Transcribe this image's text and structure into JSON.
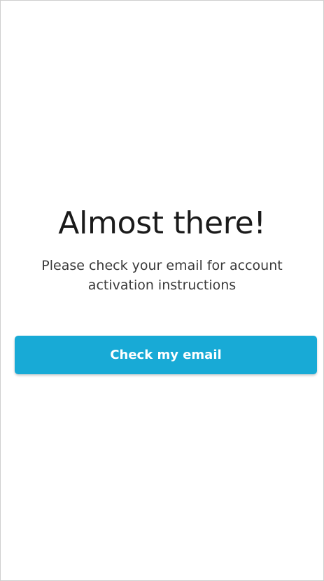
{
  "confirmation": {
    "title": "Almost there!",
    "message": "Please check your email for account activation instructions",
    "button_label": "Check my email"
  },
  "colors": {
    "accent": "#18aad6",
    "background": "#ffffff",
    "title_text": "#1a1a1a",
    "body_text": "#3a3a3a"
  }
}
